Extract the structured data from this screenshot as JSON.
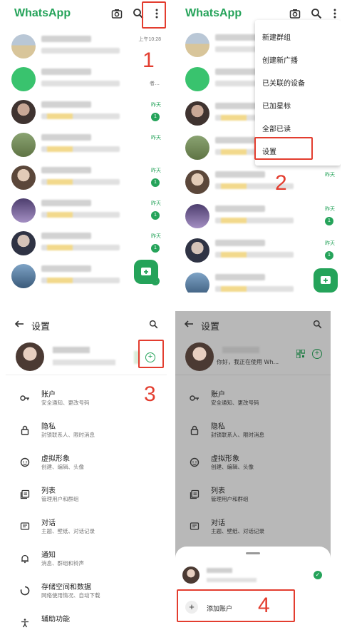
{
  "panel1": {
    "title": "WhatsApp",
    "chats": [
      {
        "time": "上午10:28",
        "time_green": false,
        "badge": "",
        "trunc": ""
      },
      {
        "time": "",
        "time_green": false,
        "badge": "",
        "trunc": "者…"
      },
      {
        "time": "昨天",
        "time_green": true,
        "badge": "1",
        "trunc": ""
      },
      {
        "time": "昨天",
        "time_green": true,
        "badge": "",
        "trunc": ""
      },
      {
        "time": "昨天",
        "time_green": true,
        "badge": "1",
        "trunc": ""
      },
      {
        "time": "昨天",
        "time_green": true,
        "badge": "1",
        "trunc": ""
      },
      {
        "time": "昨天",
        "time_green": true,
        "badge": "1",
        "trunc": ""
      },
      {
        "time": "",
        "time_green": false,
        "badge": "2",
        "trunc": ""
      }
    ],
    "step": "1"
  },
  "panel2": {
    "title": "WhatsApp",
    "menu": [
      "新建群组",
      "创建新广播",
      "已关联的设备",
      "已加星标",
      "全部已读",
      "设置"
    ],
    "chat_times": [
      "昨天",
      "昨天",
      "昨天"
    ],
    "badges": [
      "1",
      "1"
    ],
    "step": "2"
  },
  "panel3": {
    "title": "设置",
    "items": [
      {
        "icon": "key-icon",
        "label": "账户",
        "sub": "安全通知、更改号码"
      },
      {
        "icon": "lock-icon",
        "label": "隐私",
        "sub": "封锁联系人、限时消息"
      },
      {
        "icon": "avatar-face-icon",
        "label": "虚拟形象",
        "sub": "创建、编辑、头像"
      },
      {
        "icon": "list-icon",
        "label": "列表",
        "sub": "管理用户和群组"
      },
      {
        "icon": "chat-icon",
        "label": "对话",
        "sub": "主题、壁纸、对话记录"
      },
      {
        "icon": "bell-icon",
        "label": "通知",
        "sub": "消息、群组和铃声"
      },
      {
        "icon": "storage-icon",
        "label": "存储空间和数据",
        "sub": "网络使用情况、自动下载"
      },
      {
        "icon": "accessibility-icon",
        "label": "辅助功能",
        "sub": ""
      }
    ],
    "add_symbol": "+",
    "step": "3"
  },
  "panel4": {
    "title": "设置",
    "profile_status": "你好，我正在使用 Wh...",
    "items": [
      {
        "label": "账户",
        "sub": "安全通知、更改号码"
      },
      {
        "label": "隐私",
        "sub": "封锁联系人、限时消息"
      },
      {
        "label": "虚拟形象",
        "sub": "创建、编辑、头像"
      },
      {
        "label": "列表",
        "sub": "管理用户和群组"
      },
      {
        "label": "对话",
        "sub": "主题、壁纸、对话记录"
      }
    ],
    "add_account_label": "添加账户",
    "add_symbol": "+",
    "step": "4"
  },
  "colors": {
    "brand_green": "#25a35a",
    "annotation_red": "#e33d2f"
  }
}
